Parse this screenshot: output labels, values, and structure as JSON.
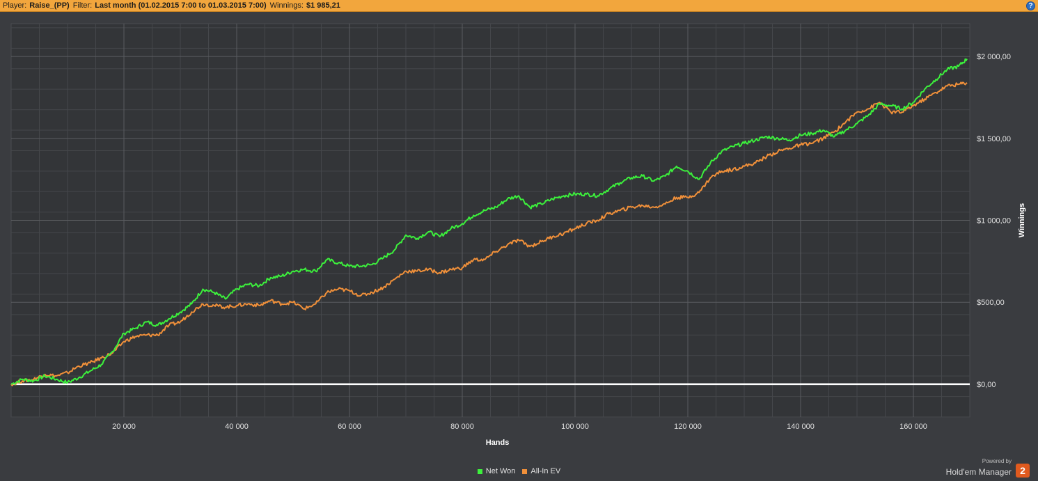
{
  "header": {
    "player_label": "Player:",
    "player_value": "Raise_(PP)",
    "filter_label": "Filter:",
    "filter_value": "Last month (01.02.2015 7:00 to 01.03.2015 7:00)",
    "winnings_label": "Winnings:",
    "winnings_value": "$1 985,21",
    "help_glyph": "?"
  },
  "colors": {
    "background": "#3a3c40",
    "plot_background": "#333538",
    "header_bar": "#f2a63d",
    "net_won": "#3cf03c",
    "all_in_ev": "#f0903a",
    "zero_line": "#ffffff",
    "grid": "#5a5c60"
  },
  "chart_data": {
    "type": "line",
    "xlabel": "Hands",
    "ylabel": "Winnings",
    "xlim": [
      0,
      170000
    ],
    "ylim": [
      -200,
      2200
    ],
    "x_ticks": [
      20000,
      40000,
      60000,
      80000,
      100000,
      120000,
      140000,
      160000
    ],
    "x_tick_labels": [
      "20 000",
      "40 000",
      "60 000",
      "80 000",
      "100 000",
      "120 000",
      "140 000",
      "160 000"
    ],
    "y_ticks": [
      0,
      500,
      1000,
      1500,
      2000
    ],
    "y_tick_labels": [
      "$0,00",
      "$500,00",
      "$1 000,00",
      "$1 500,00",
      "$2 000,00"
    ],
    "grid": true,
    "legend_position": "bottom-center",
    "series": [
      {
        "name": "Net Won",
        "x": [
          0,
          2000,
          4000,
          6000,
          8000,
          10000,
          12000,
          14000,
          16000,
          18000,
          20000,
          22000,
          24000,
          26000,
          28000,
          30000,
          32000,
          34000,
          36000,
          38000,
          40000,
          42000,
          44000,
          46000,
          48000,
          50000,
          52000,
          54000,
          56000,
          58000,
          60000,
          62000,
          64000,
          66000,
          68000,
          70000,
          72000,
          74000,
          76000,
          78000,
          80000,
          82000,
          84000,
          86000,
          88000,
          90000,
          92000,
          94000,
          96000,
          98000,
          100000,
          102000,
          104000,
          106000,
          108000,
          110000,
          112000,
          114000,
          116000,
          118000,
          120000,
          122000,
          124000,
          126000,
          128000,
          130000,
          132000,
          134000,
          136000,
          138000,
          140000,
          142000,
          144000,
          146000,
          148000,
          150000,
          152000,
          154000,
          156000,
          158000,
          160000,
          162000,
          164000,
          166000,
          168000,
          169500
        ],
        "values": [
          0,
          30,
          20,
          50,
          30,
          10,
          40,
          80,
          120,
          200,
          310,
          340,
          380,
          360,
          400,
          440,
          490,
          580,
          560,
          520,
          580,
          610,
          600,
          650,
          660,
          690,
          700,
          690,
          760,
          740,
          720,
          720,
          730,
          770,
          820,
          910,
          890,
          930,
          900,
          950,
          980,
          1030,
          1060,
          1080,
          1130,
          1150,
          1080,
          1100,
          1130,
          1150,
          1160,
          1160,
          1150,
          1190,
          1230,
          1260,
          1270,
          1240,
          1270,
          1330,
          1300,
          1250,
          1350,
          1420,
          1450,
          1470,
          1490,
          1510,
          1500,
          1490,
          1520,
          1530,
          1550,
          1510,
          1550,
          1590,
          1640,
          1710,
          1700,
          1680,
          1720,
          1800,
          1860,
          1920,
          1940,
          1985
        ]
      },
      {
        "name": "All-In EV",
        "x": [
          0,
          2000,
          4000,
          6000,
          8000,
          10000,
          12000,
          14000,
          16000,
          18000,
          20000,
          22000,
          24000,
          26000,
          28000,
          30000,
          32000,
          34000,
          36000,
          38000,
          40000,
          42000,
          44000,
          46000,
          48000,
          50000,
          52000,
          54000,
          56000,
          58000,
          60000,
          62000,
          64000,
          66000,
          68000,
          70000,
          72000,
          74000,
          76000,
          78000,
          80000,
          82000,
          84000,
          86000,
          88000,
          90000,
          92000,
          94000,
          96000,
          98000,
          100000,
          102000,
          104000,
          106000,
          108000,
          110000,
          112000,
          114000,
          116000,
          118000,
          120000,
          122000,
          124000,
          126000,
          128000,
          130000,
          132000,
          134000,
          136000,
          138000,
          140000,
          142000,
          144000,
          146000,
          148000,
          150000,
          152000,
          154000,
          156000,
          158000,
          160000,
          162000,
          164000,
          166000,
          168000,
          169500
        ],
        "values": [
          0,
          20,
          30,
          60,
          50,
          70,
          110,
          130,
          160,
          190,
          260,
          290,
          300,
          300,
          360,
          380,
          440,
          490,
          480,
          470,
          480,
          490,
          480,
          510,
          490,
          500,
          460,
          490,
          560,
          580,
          570,
          540,
          560,
          590,
          640,
          690,
          690,
          700,
          680,
          700,
          710,
          760,
          760,
          810,
          850,
          880,
          840,
          870,
          900,
          920,
          950,
          980,
          1000,
          1040,
          1060,
          1080,
          1090,
          1080,
          1100,
          1140,
          1140,
          1170,
          1260,
          1300,
          1310,
          1330,
          1350,
          1390,
          1420,
          1440,
          1460,
          1470,
          1500,
          1540,
          1600,
          1660,
          1680,
          1720,
          1660,
          1660,
          1700,
          1740,
          1780,
          1820,
          1830,
          1840
        ]
      }
    ]
  },
  "legend": {
    "items": [
      {
        "label": "Net Won",
        "color": "#3cf03c"
      },
      {
        "label": "All-In EV",
        "color": "#f0903a"
      }
    ]
  },
  "branding": {
    "powered_by": "Powered by",
    "product": "Hold'em Manager",
    "badge": "2"
  }
}
